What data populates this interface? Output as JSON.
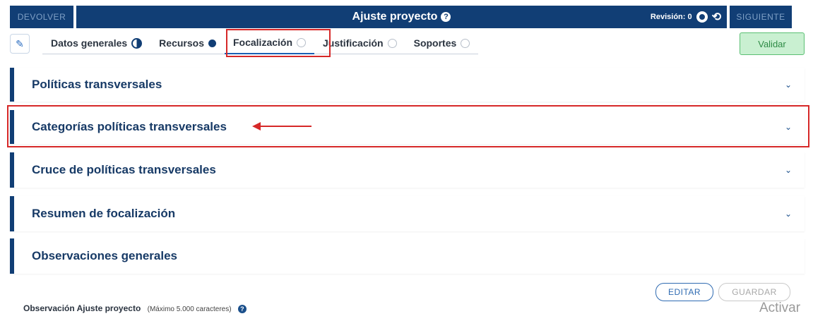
{
  "header": {
    "left_button": "DEVOLVER",
    "title": "Ajuste proyecto",
    "revision_label": "Revisión: 0",
    "right_button": "SIGUIENTE"
  },
  "tabs": [
    {
      "label": "Datos generales",
      "status": "half"
    },
    {
      "label": "Recursos",
      "status": "full"
    },
    {
      "label": "Focalización",
      "status": "empty",
      "active": true
    },
    {
      "label": "Justificación",
      "status": "empty"
    },
    {
      "label": "Soportes",
      "status": "empty"
    }
  ],
  "validate_label": "Validar",
  "sections": [
    {
      "title": "Políticas transversales",
      "chevron": "chevron-down-icon"
    },
    {
      "title": "Categorías políticas transversales",
      "chevron": "chevron-down-icon"
    },
    {
      "title": "Cruce de políticas transversales",
      "chevron": "chevron-down-icon"
    },
    {
      "title": "Resumen de focalización",
      "chevron": "chevron-down-icon"
    },
    {
      "title": "Observaciones generales"
    }
  ],
  "observacion": {
    "label": "Observación Ajuste proyecto",
    "hint": "(Máximo 5.000 caracteres)",
    "edit_button": "EDITAR",
    "save_button": "GUARDAR"
  },
  "watermark": "Activar",
  "colors": {
    "primary": "#113e75",
    "accent_red": "#d62828",
    "validate_bg": "#c9f0d1"
  }
}
